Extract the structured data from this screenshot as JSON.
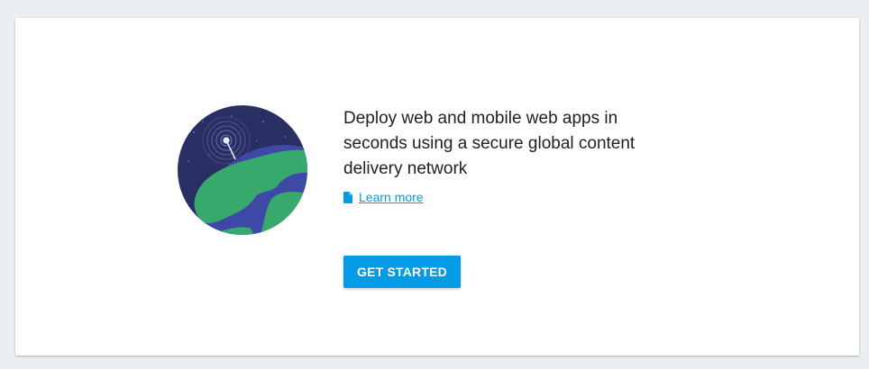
{
  "card": {
    "headline": "Deploy web and mobile web apps in seconds using a secure global content delivery network",
    "learn_more": "Learn more",
    "cta": "GET STARTED"
  },
  "icons": {
    "illustration": "globe-with-satellite-beacon",
    "doc": "document-icon"
  },
  "colors": {
    "accent": "#039be5",
    "space": "#2a2f63",
    "ocean": "#3e48a6",
    "land": "#38a96c",
    "text": "#212121",
    "page_bg": "#eceff1"
  }
}
